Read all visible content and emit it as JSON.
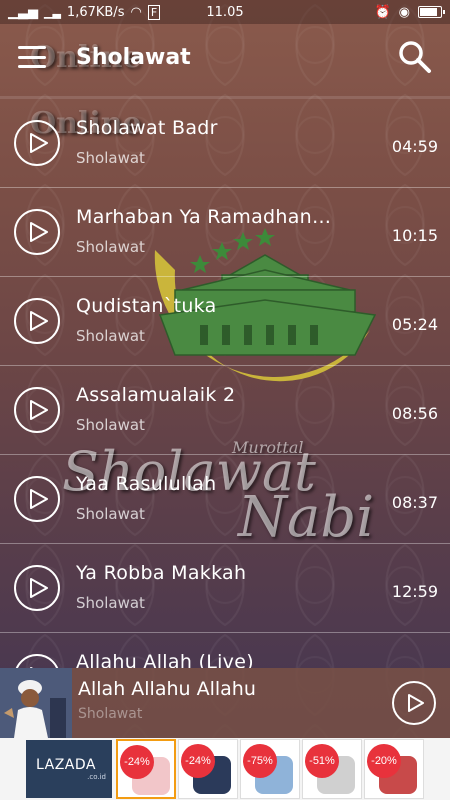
{
  "status_bar": {
    "network_speed": "1,67KB/s",
    "time": "11.05",
    "battery_percent": 85
  },
  "app_bar": {
    "title": "Sholawat"
  },
  "watermark": {
    "line1": "Sholawat",
    "line2": "Nabi",
    "small": "Murottal",
    "online": "Online"
  },
  "tracks": [
    {
      "title": "Sholawat Badr",
      "subtitle": "Sholawat",
      "duration": "04:59"
    },
    {
      "title": "Marhaban Ya Ramadhan…",
      "subtitle": "Sholawat",
      "duration": "10:15"
    },
    {
      "title": "Qudistan`tuka",
      "subtitle": "Sholawat",
      "duration": "05:24"
    },
    {
      "title": " Assalamualaik 2",
      "subtitle": "Sholawat",
      "duration": "08:56"
    },
    {
      "title": "Yaa Rasulullah",
      "subtitle": "Sholawat",
      "duration": "08:37"
    },
    {
      "title": "Ya Robba Makkah",
      "subtitle": "Sholawat",
      "duration": "12:59"
    },
    {
      "title": "Allahu Allah (Live)",
      "subtitle": "",
      "duration": ""
    }
  ],
  "now_playing": {
    "title": "Allah Allahu Allahu",
    "subtitle": "Sholawat"
  },
  "ad": {
    "brand": "LAZADA",
    "domain": ".co.id",
    "items": [
      {
        "discount": "-24%",
        "selected": true
      },
      {
        "discount": "-24%",
        "selected": false
      },
      {
        "discount": "-75%",
        "selected": false
      },
      {
        "discount": "-51%",
        "selected": false
      },
      {
        "discount": "-20%",
        "selected": false
      }
    ]
  }
}
